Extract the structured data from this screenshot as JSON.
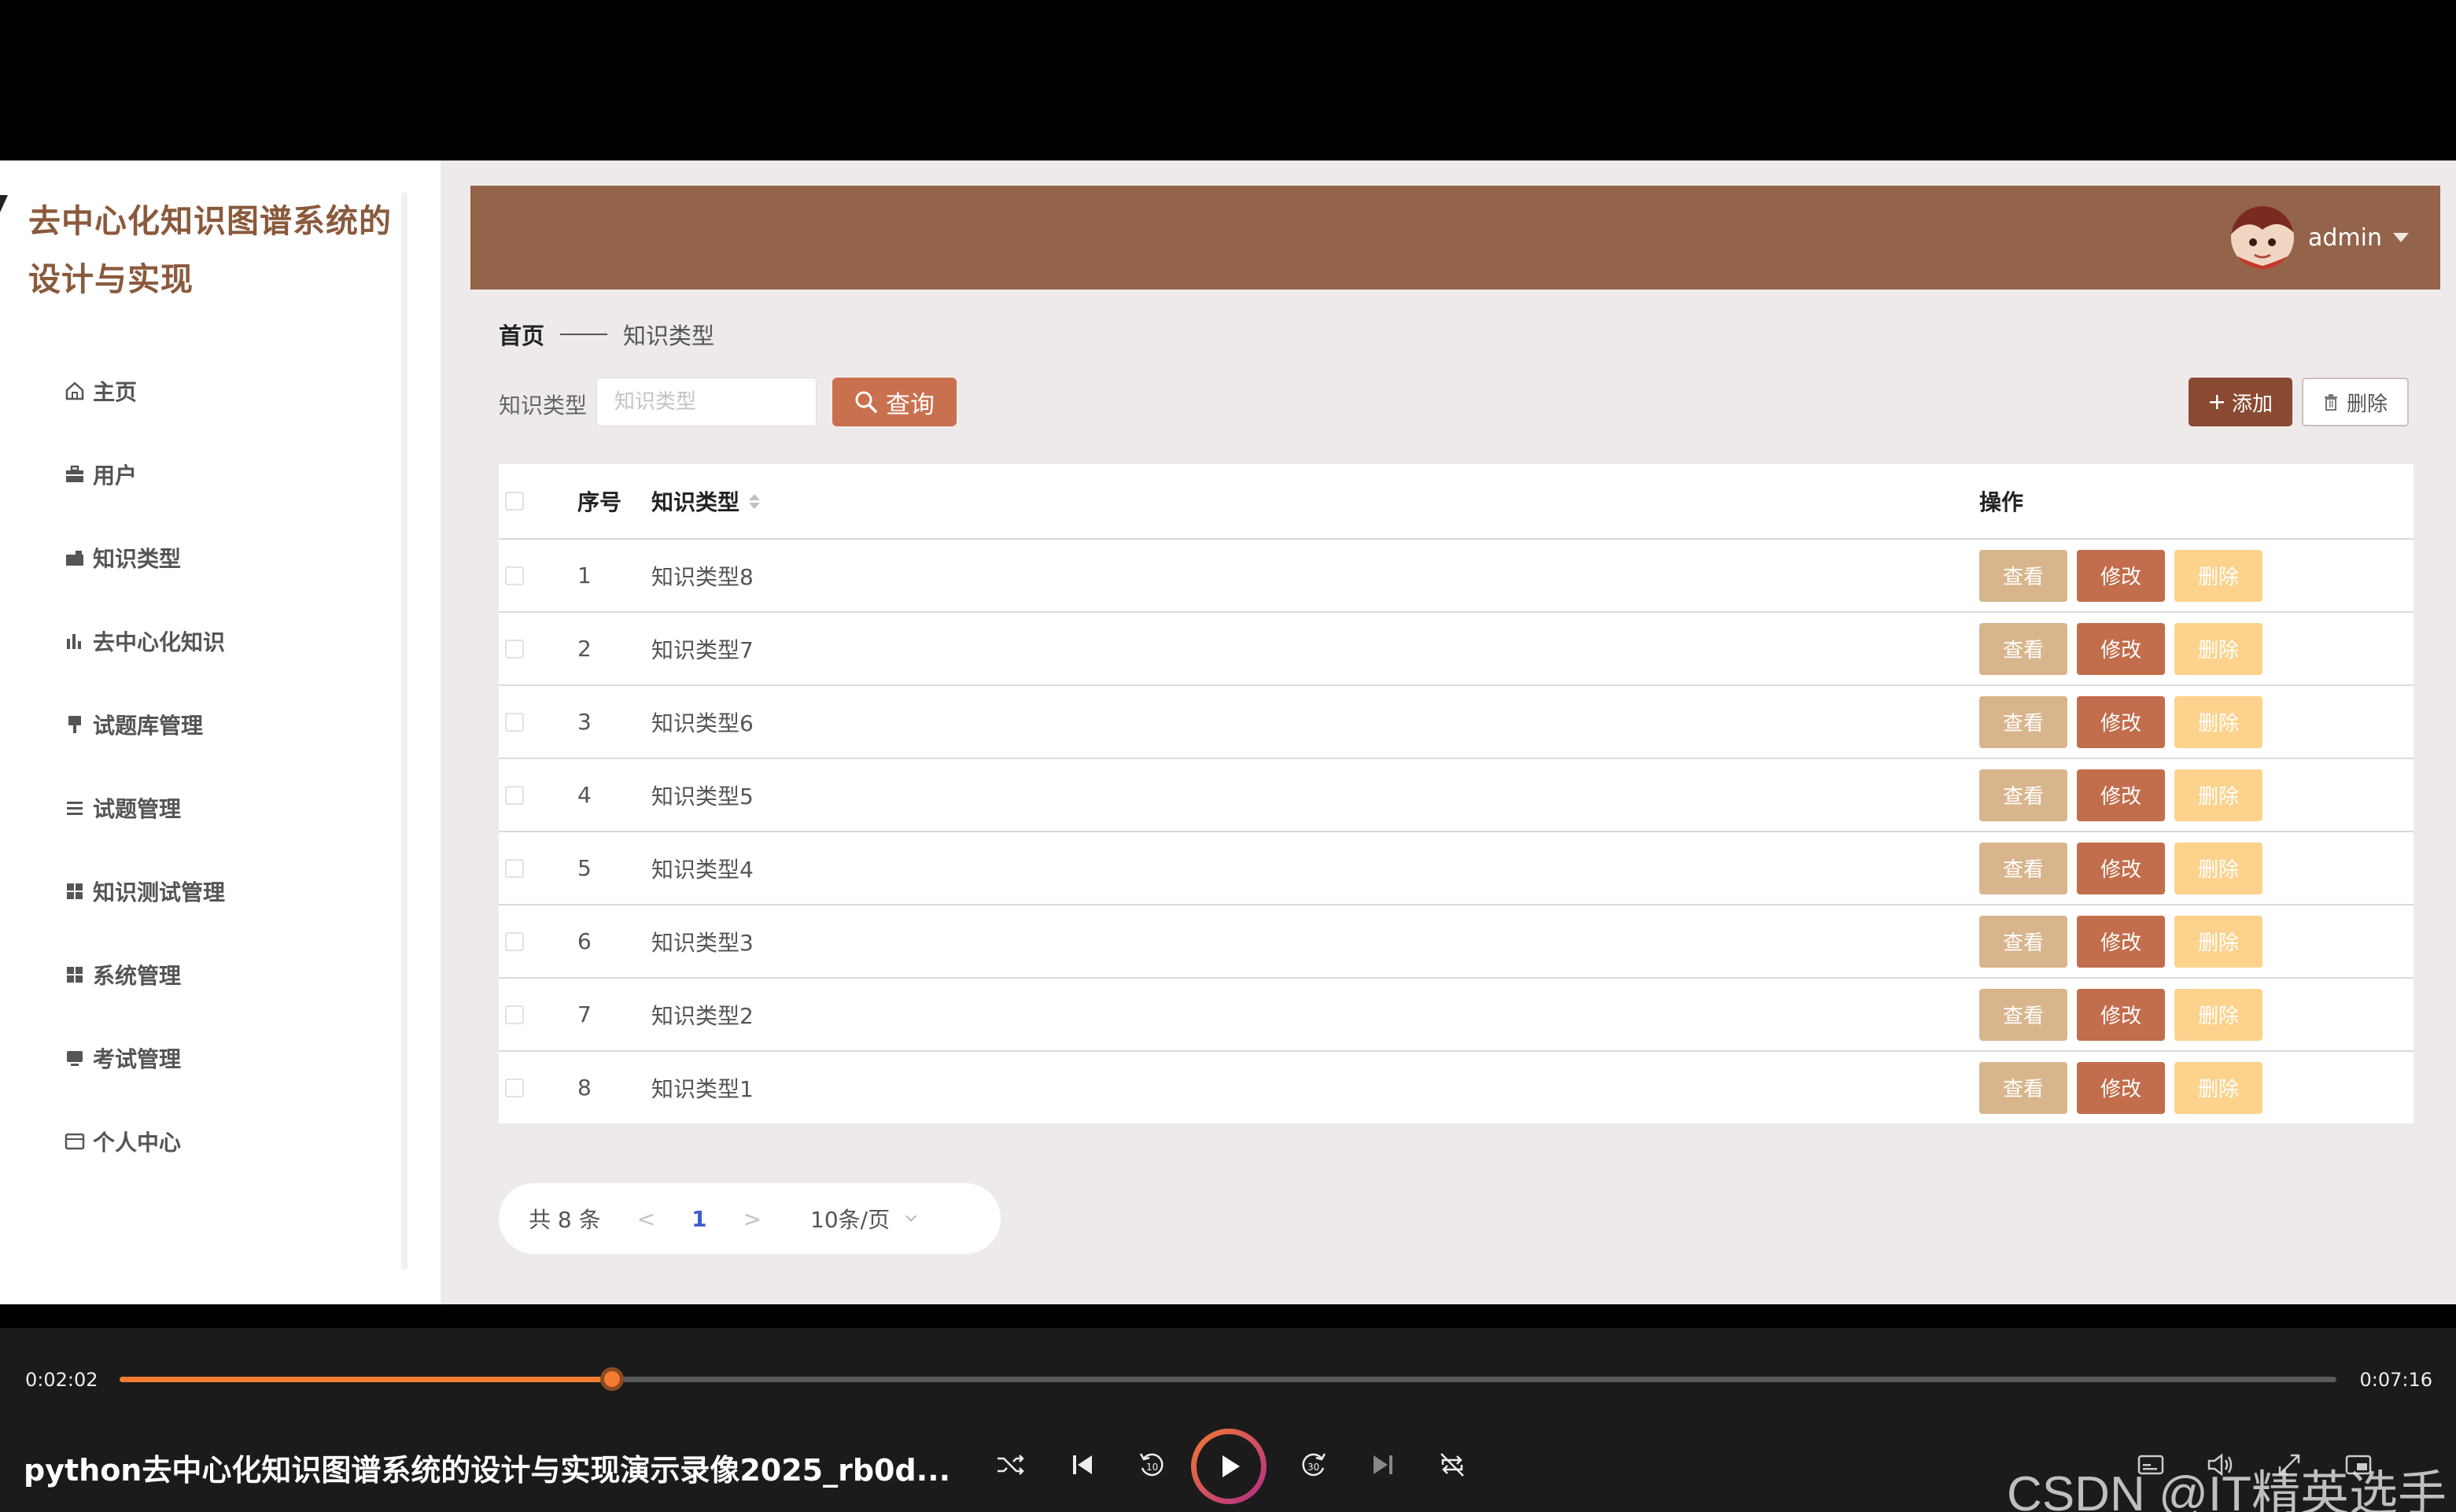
{
  "app": {
    "title": "去中心化知识图谱系统的设计与实现",
    "user_name": "admin"
  },
  "sidebar": {
    "items": [
      {
        "label": "主页",
        "icon": "home-icon"
      },
      {
        "label": "用户",
        "icon": "briefcase-icon"
      },
      {
        "label": "知识类型",
        "icon": "folder-icon"
      },
      {
        "label": "去中心化知识",
        "icon": "bar-chart-icon"
      },
      {
        "label": "试题库管理",
        "icon": "pin-icon"
      },
      {
        "label": "试题管理",
        "icon": "list-icon"
      },
      {
        "label": "知识测试管理",
        "icon": "grid-icon"
      },
      {
        "label": "系统管理",
        "icon": "grid-icon"
      },
      {
        "label": "考试管理",
        "icon": "monitor-icon"
      },
      {
        "label": "个人中心",
        "icon": "window-icon"
      }
    ]
  },
  "breadcrumb": {
    "home": "首页",
    "current": "知识类型"
  },
  "search": {
    "label": "知识类型",
    "placeholder": "知识类型",
    "button": "查询"
  },
  "toolbar": {
    "add": "添加",
    "delete": "删除"
  },
  "table": {
    "headers": {
      "index": "序号",
      "type": "知识类型",
      "ops": "操作"
    },
    "op_labels": {
      "view": "查看",
      "edit": "修改",
      "delete": "删除"
    },
    "rows": [
      {
        "index": "1",
        "type": "知识类型8"
      },
      {
        "index": "2",
        "type": "知识类型7"
      },
      {
        "index": "3",
        "type": "知识类型6"
      },
      {
        "index": "4",
        "type": "知识类型5"
      },
      {
        "index": "5",
        "type": "知识类型4"
      },
      {
        "index": "6",
        "type": "知识类型3"
      },
      {
        "index": "7",
        "type": "知识类型2"
      },
      {
        "index": "8",
        "type": "知识类型1"
      }
    ]
  },
  "pagination": {
    "total": "共 8 条",
    "prev": "<",
    "page": "1",
    "next": ">",
    "page_size": "10条/页"
  },
  "player": {
    "current_time": "0:02:02",
    "total_time": "0:07:16",
    "progress": 0.222,
    "video_title": "python去中心化知识图谱系统的设计与实现演示录像2025_rb0d...",
    "watermark": "CSDN @IT精英选手"
  },
  "colors": {
    "topbar": "#93634a",
    "accent": "#c9714f",
    "view_button": "#d8b58c",
    "edit_button": "#c26d4c",
    "delete_button": "#fcd28d",
    "progress": "#f47b30"
  }
}
